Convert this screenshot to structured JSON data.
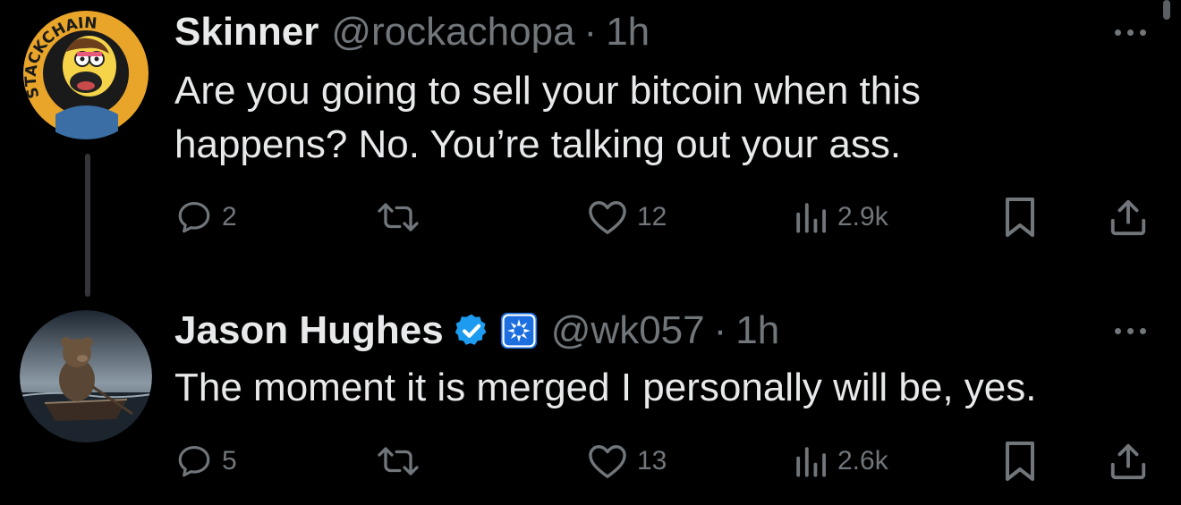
{
  "colors": {
    "background": "#000000",
    "primary_text": "#e7e9ea",
    "secondary_text": "#71767b",
    "verified_badge": "#1d9bf0",
    "thread_line": "#333639"
  },
  "tweets": [
    {
      "display_name": "Skinner",
      "handle": "@rockachopa",
      "separator": "·",
      "time": "1h",
      "text_line1": "Are you going to sell your bitcoin when this",
      "text_line2": "happens? No. You’re talking out your ass.",
      "avatar_icon": "cartoon-avatar-icon",
      "avatar_ring_text": "STACKCHAIN",
      "replies": "2",
      "retweets": "",
      "likes": "12",
      "views": "2.9k"
    },
    {
      "display_name": "Jason Hughes",
      "handle": "@wk057",
      "separator": "·",
      "time": "1h",
      "text_line1": "The moment it is merged I personally will be, yes.",
      "avatar_icon": "teddy-bear-boat-avatar-icon",
      "verified": true,
      "affiliate_badge_icon": "affiliate-badge-icon",
      "replies": "5",
      "retweets": "",
      "likes": "13",
      "views": "2.6k"
    }
  ]
}
